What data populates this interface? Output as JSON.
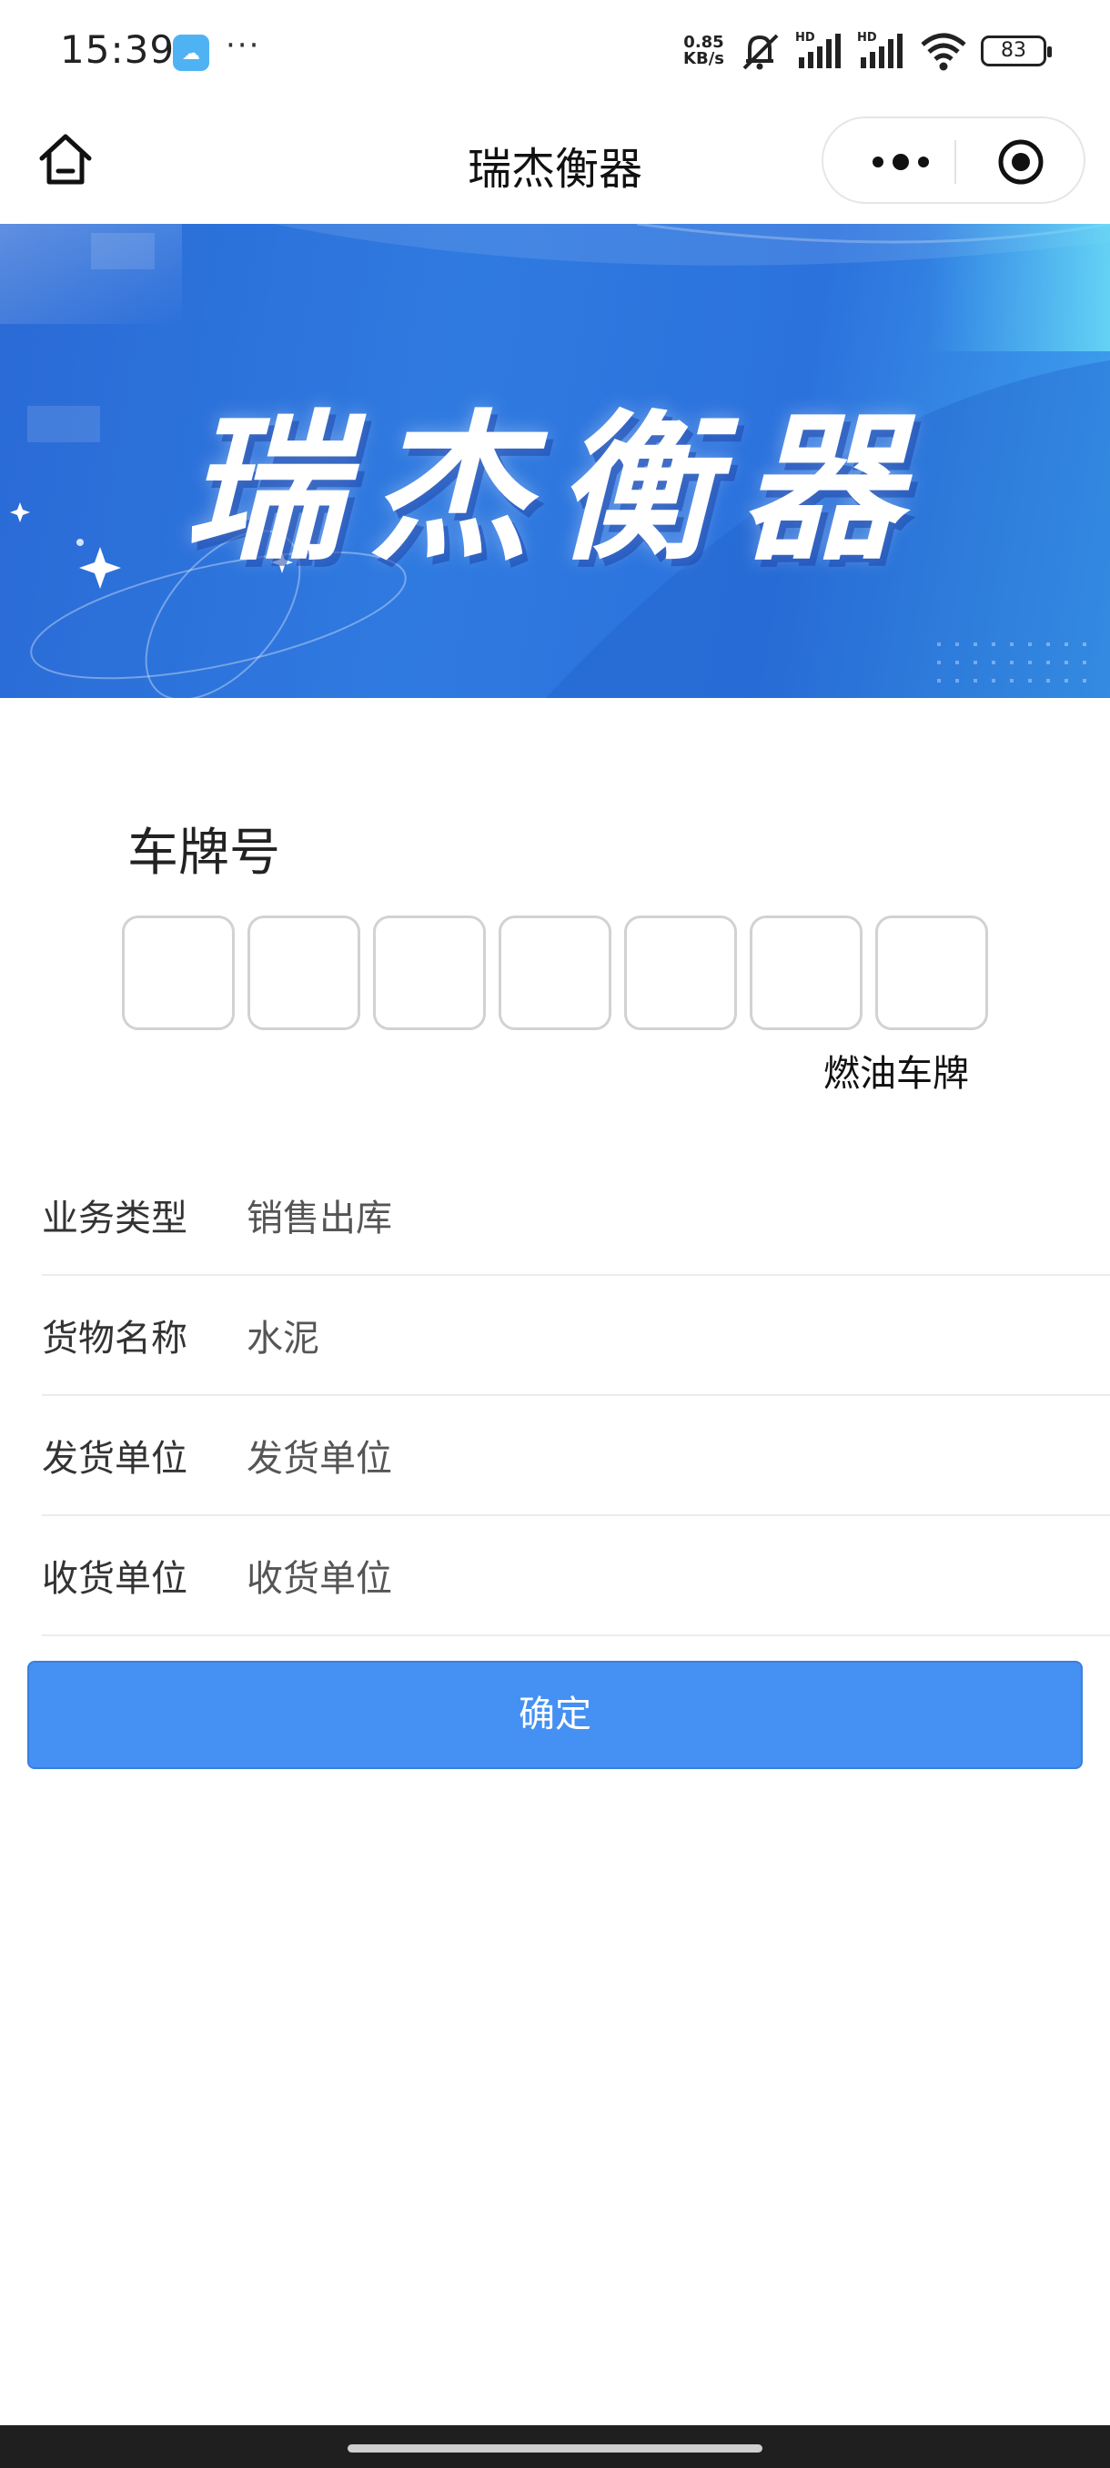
{
  "status_bar": {
    "time": "15:39",
    "more": "···",
    "net_speed_value": "0.85",
    "net_speed_unit": "KB/s",
    "hd1": "HD",
    "hd2": "HD",
    "battery": "83"
  },
  "nav": {
    "title": "瑞杰衡器"
  },
  "banner": {
    "title": "瑞杰衡器"
  },
  "plate": {
    "label": "车牌号",
    "type_text": "燃油车牌",
    "box_count": 7
  },
  "form": {
    "rows": [
      {
        "label": "业务类型",
        "value": "销售出库"
      },
      {
        "label": "货物名称",
        "value": "水泥"
      },
      {
        "label": "发货单位",
        "value": "发货单位"
      },
      {
        "label": "收货单位",
        "value": "收货单位"
      }
    ]
  },
  "confirm_label": "确定",
  "colors": {
    "primary_button": "#4590f3",
    "banner_blue": "#2f7ae0"
  }
}
